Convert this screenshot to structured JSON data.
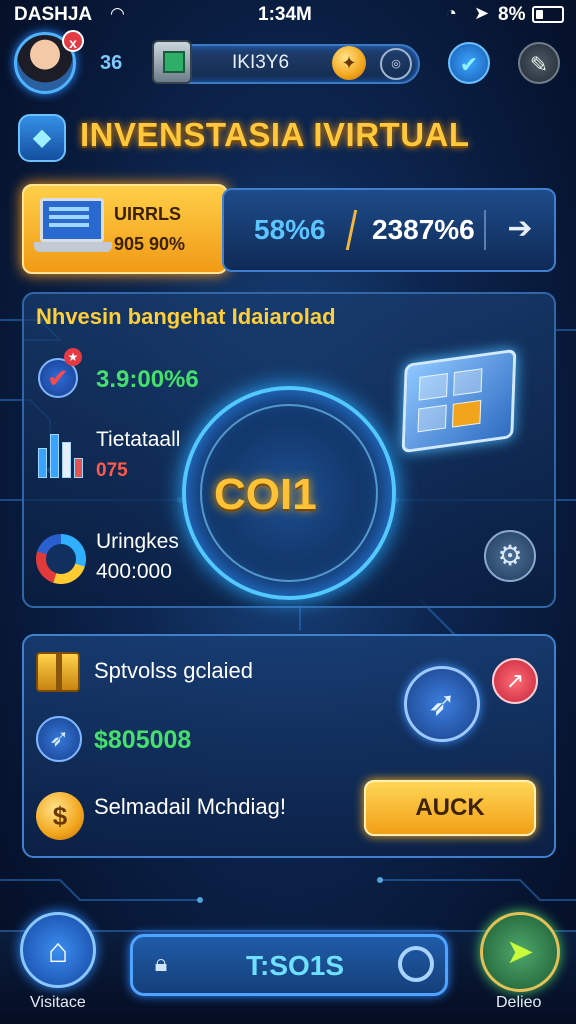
{
  "status_bar": {
    "carrier": "DASHJA",
    "time": "1:34M",
    "battery": "8%"
  },
  "header": {
    "level": "36",
    "avatar_badge": "x",
    "resource_value": "IKI3Y6"
  },
  "title": "INVENSTASIA IVIRTUAL",
  "stats": {
    "card_title": "UIRRLS",
    "card_value": "905 90%",
    "percent_a": "58%6",
    "percent_b": "2387%6"
  },
  "mid_panel": {
    "heading": "Nhvesin bangehat Idaiarolad",
    "rows": [
      {
        "value": "3.9:00%6"
      },
      {
        "label": "Tietataall",
        "value": "075"
      },
      {
        "label": "Uringkes",
        "value": "400:000"
      }
    ],
    "center_coin": "COI1"
  },
  "bottom_panel": {
    "row1_label": "Sptvolss gclaied",
    "row2_value": "$805008",
    "row3_label": "Selmadail Mchdiag!",
    "action_button": "AUCK"
  },
  "bottom_nav": {
    "home_label": "Visitace",
    "center_label": "T:SO1S",
    "go_label": "Delieo"
  },
  "colors": {
    "accent_gold": "#ffc83d",
    "accent_blue": "#4fa4ff",
    "value_green": "#45e06c",
    "value_red": "#ff5a4a"
  }
}
